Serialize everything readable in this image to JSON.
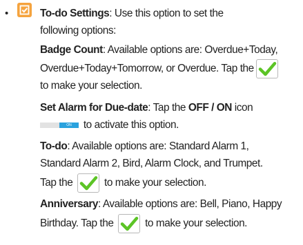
{
  "bullet": "•",
  "todo": {
    "title": "To-do Settings",
    "intro_1": ": Use this option to set the",
    "intro_2": "following options:"
  },
  "badge_count": {
    "label": "Badge Count",
    "text_1": ": Available options are: Overdue+Today,",
    "text_2": "Overdue+Today+Tomorrow, or Overdue. Tap the",
    "text_3": "to make your selection."
  },
  "set_alarm": {
    "label": "Set Alarm for Due-date",
    "text_1": ": Tap the ",
    "off_on": "OFF / ON",
    "text_2": " icon",
    "toggle_label": "ON",
    "text_3": " to activate this option."
  },
  "todo_alarm": {
    "label": "To-do",
    "text_1": ": Available options are: Standard Alarm 1,",
    "text_2": "Standard Alarm 2, Bird, Alarm Clock, and Trumpet.",
    "text_3_pre": "Tap the ",
    "text_3_post": " to make your selection."
  },
  "anniversary": {
    "label": "Anniversary",
    "text_1": ": Available options are: Bell, Piano, Happy",
    "text_2_pre": "Birthday. Tap the ",
    "text_2_post": " to make your selection."
  },
  "colors": {
    "todo_icon": "#f5a33e",
    "check": "#5cc426",
    "toggle_on": "#2aa2de"
  },
  "icons": {
    "todo": "checkbox-icon",
    "check": "checkmark-icon",
    "toggle": "toggle-switch-icon"
  }
}
